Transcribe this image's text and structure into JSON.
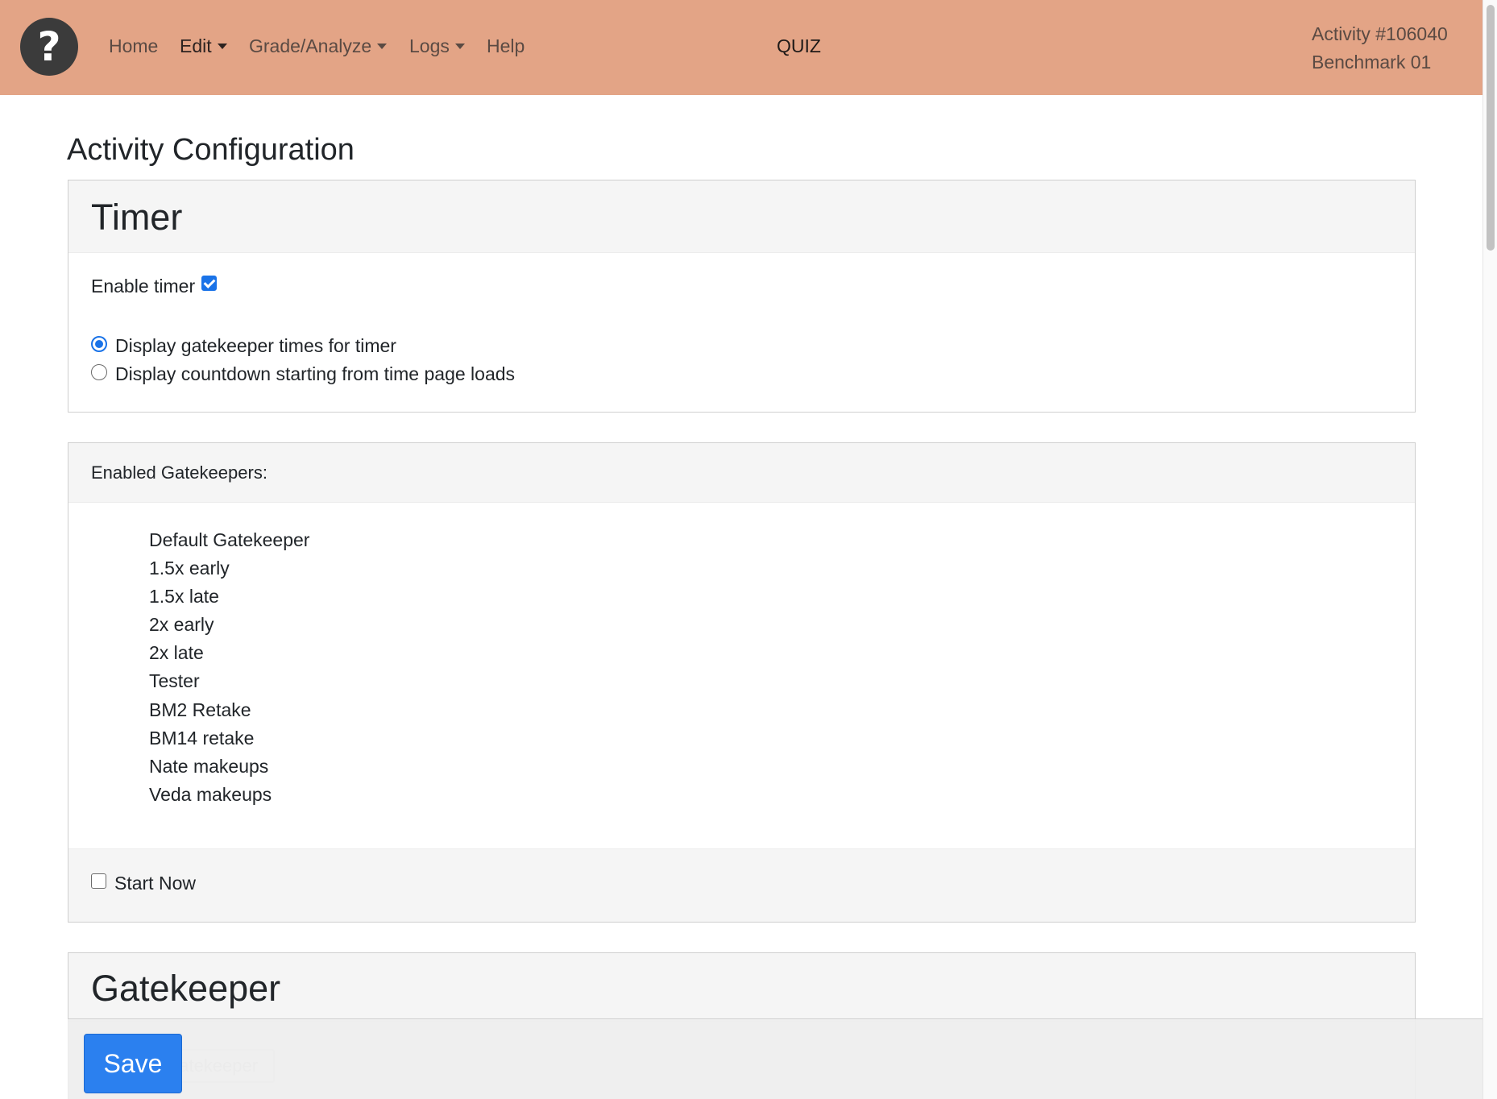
{
  "navbar": {
    "logo_glyph": "?",
    "items": [
      {
        "label": "Home",
        "has_dropdown": false
      },
      {
        "label": "Edit",
        "has_dropdown": true
      },
      {
        "label": "Grade/Analyze",
        "has_dropdown": true
      },
      {
        "label": "Logs",
        "has_dropdown": true
      },
      {
        "label": "Help",
        "has_dropdown": false
      }
    ],
    "center_title": "QUIZ",
    "activity_id": "Activity #106040",
    "activity_name": "Benchmark 01",
    "background_color": "#e3a486"
  },
  "page": {
    "title": "Activity Configuration"
  },
  "timer_card": {
    "title": "Timer",
    "enable_label": "Enable timer",
    "enable_checked": true,
    "options": [
      {
        "label": "Display gatekeeper times for timer",
        "selected": true
      },
      {
        "label": "Display countdown starting from time page loads",
        "selected": false
      }
    ]
  },
  "gatekeepers_card": {
    "header": "Enabled Gatekeepers:",
    "items": [
      "Default Gatekeeper",
      "1.5x early",
      "1.5x late",
      "2x early",
      "2x late",
      "Tester",
      "BM2 Retake",
      "BM14 retake",
      "Nate makeups",
      "Veda makeups"
    ],
    "start_now_label": "Start Now",
    "start_now_checked": false
  },
  "gatekeeper_card": {
    "title": "Gatekeeper",
    "partial_button_label": "gatekeeper"
  },
  "save_bar": {
    "save_label": "Save",
    "accent_color": "#2b80ef"
  }
}
